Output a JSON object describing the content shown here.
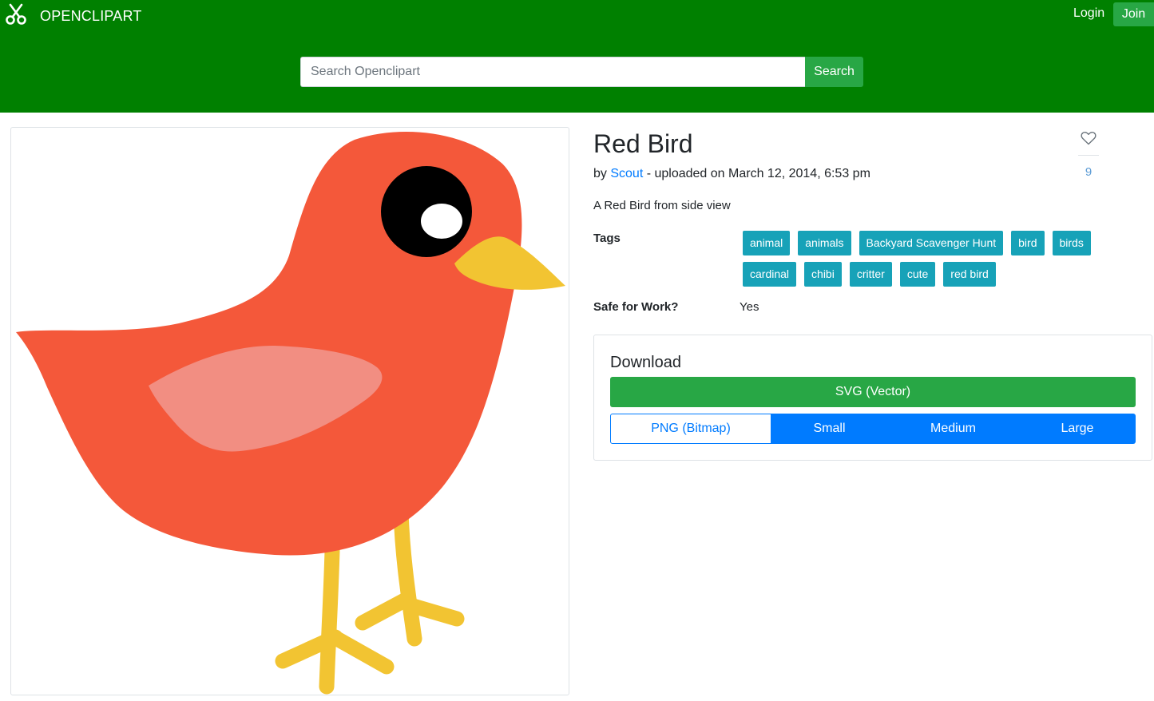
{
  "header": {
    "brand": "OPENCLIPART",
    "login_label": "Login",
    "join_label": "Join",
    "search_placeholder": "Search Openclipart",
    "search_button": "Search"
  },
  "clipart": {
    "title": "Red Bird",
    "by_prefix": "by ",
    "author": "Scout",
    "uploaded_text": " - uploaded on March 12, 2014, 6:53 pm",
    "description": "A Red Bird from side view",
    "favorite_count": "9",
    "tags_label": "Tags",
    "tags": [
      "animal",
      "animals",
      "Backyard Scavenger Hunt",
      "bird",
      "birds",
      "cardinal",
      "chibi",
      "critter",
      "cute",
      "red bird"
    ],
    "sfw_label": "Safe for Work?",
    "sfw_value": "Yes"
  },
  "download": {
    "title": "Download",
    "svg_label": "SVG (Vector)",
    "png_label": "PNG (Bitmap)",
    "sizes": [
      "Small",
      "Medium",
      "Large"
    ]
  },
  "colors": {
    "header_bg": "#008000",
    "success": "#28a745",
    "primary": "#007bff",
    "tag": "#17a2b8",
    "bird_body": "#f4583a",
    "bird_wing": "#f28e82",
    "bird_beak": "#f2c432"
  },
  "icons": {
    "brand": "scissors-icon",
    "favorite": "heart-icon"
  }
}
